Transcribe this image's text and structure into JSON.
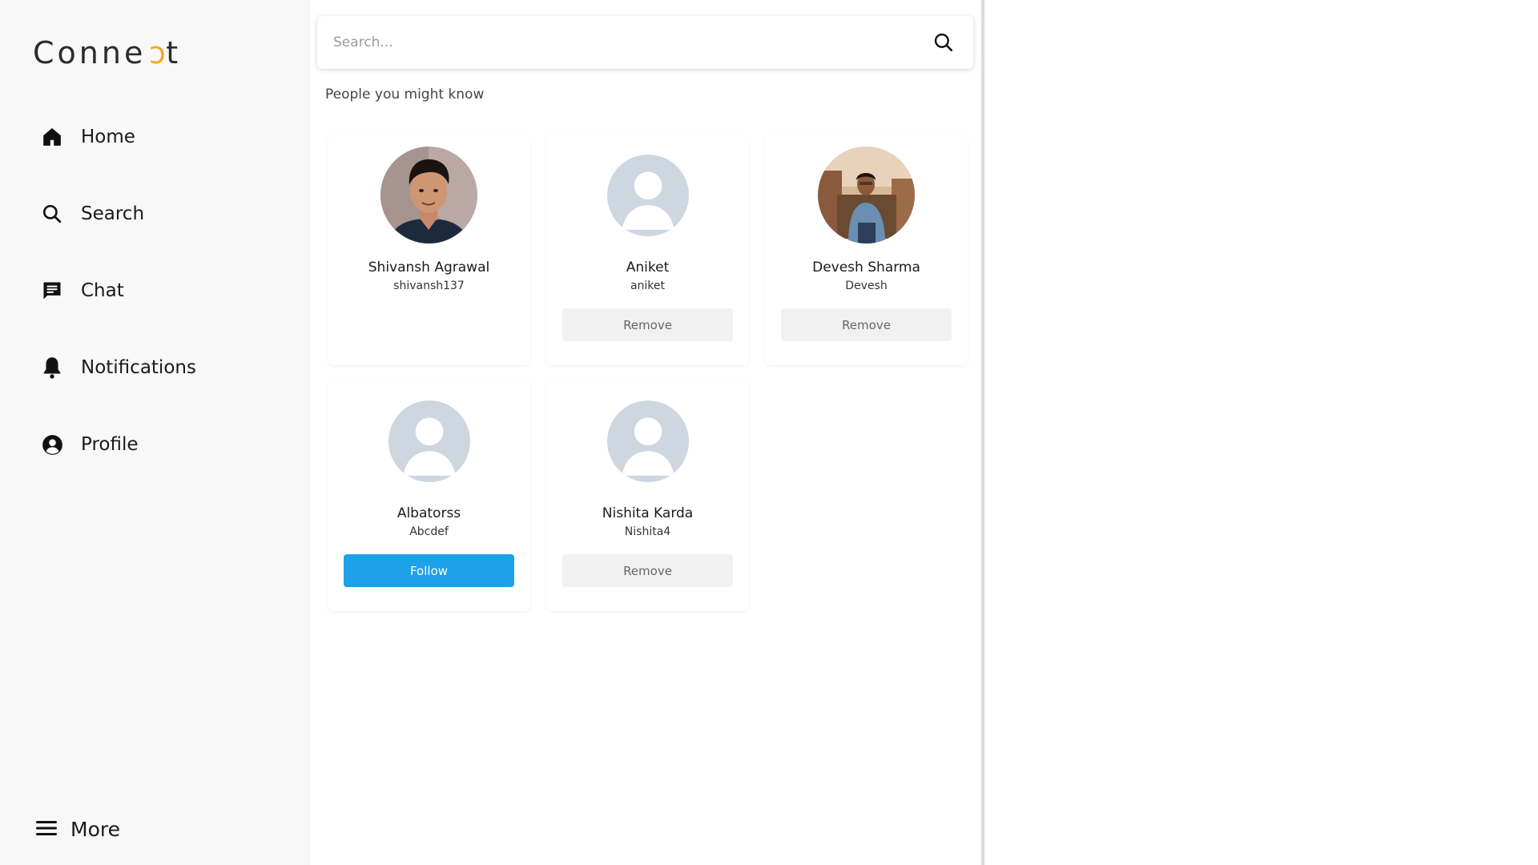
{
  "app": {
    "logo_prefix": "Conne",
    "logo_accent": "c",
    "logo_suffix": "t",
    "accent_color": "#f5a623"
  },
  "sidebar": {
    "items": [
      {
        "label": "Home",
        "icon": "home-icon"
      },
      {
        "label": "Search",
        "icon": "search-icon"
      },
      {
        "label": "Chat",
        "icon": "chat-icon"
      },
      {
        "label": "Notifications",
        "icon": "bell-icon"
      },
      {
        "label": "Profile",
        "icon": "user-circle-icon"
      }
    ],
    "more_label": "More",
    "more_icon": "hamburger-menu-icon"
  },
  "search": {
    "placeholder": "Search...",
    "value": ""
  },
  "suggestions": {
    "title": "People you might know",
    "people": [
      {
        "name": "Shivansh Agrawal",
        "handle": "shivansh137",
        "avatar": "photo",
        "action": ""
      },
      {
        "name": "Aniket",
        "handle": "aniket",
        "avatar": "placeholder",
        "action": "Remove"
      },
      {
        "name": "Devesh Sharma",
        "handle": "Devesh",
        "avatar": "photo",
        "action": "Remove"
      },
      {
        "name": "Albatorss",
        "handle": "Abcdef",
        "avatar": "placeholder",
        "action": "Follow"
      },
      {
        "name": "Nishita Karda",
        "handle": "Nishita4",
        "avatar": "placeholder",
        "action": "Remove"
      }
    ]
  },
  "colors": {
    "follow_button": "#1da1e9",
    "remove_button": "#f1f1f1",
    "sidebar_bg": "#f8f8f8",
    "avatar_placeholder": "#ced6e0"
  }
}
